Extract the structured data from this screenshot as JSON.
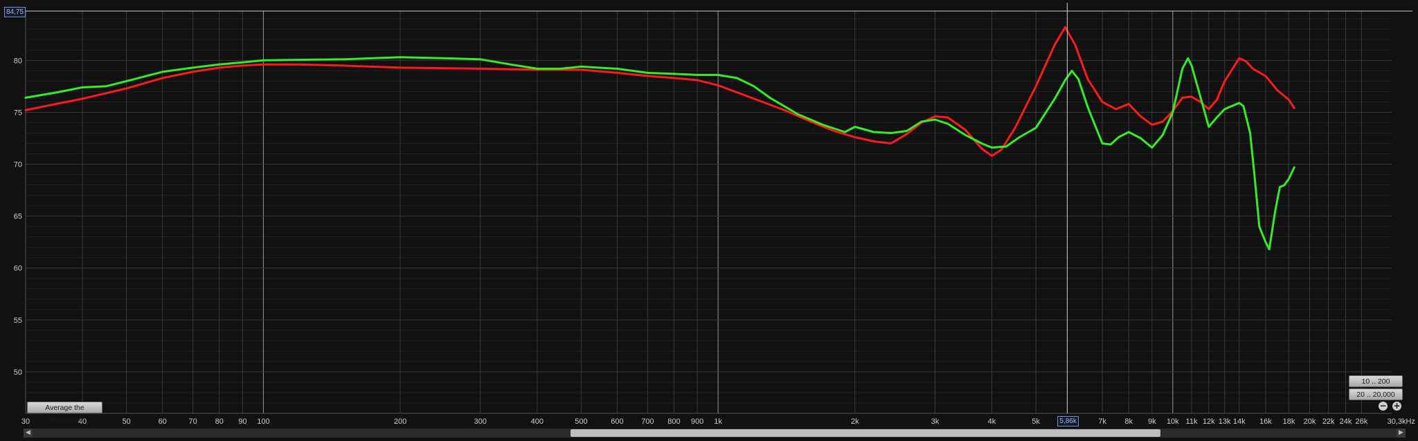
{
  "chart_data": {
    "type": "line",
    "title": "",
    "xlabel": "Hz",
    "ylabel": "",
    "x_scale": "log",
    "xlim": [
      30,
      30300
    ],
    "ylim": [
      46,
      84.75
    ],
    "grid": true,
    "x_tick_labels": [
      "30",
      "40",
      "50",
      "60",
      "70",
      "80",
      "90",
      "100",
      "200",
      "300",
      "400",
      "500",
      "600",
      "700",
      "800",
      "900",
      "1k",
      "2k",
      "3k",
      "4k",
      "5k",
      "7k",
      "8k",
      "9k",
      "10k",
      "11k",
      "12k",
      "13k",
      "14k",
      "16k",
      "18k",
      "20k",
      "22k",
      "24k",
      "26k"
    ],
    "x_tick_values": [
      30,
      40,
      50,
      60,
      70,
      80,
      90,
      100,
      200,
      300,
      400,
      500,
      600,
      700,
      800,
      900,
      1000,
      2000,
      3000,
      4000,
      5000,
      7000,
      8000,
      9000,
      10000,
      11000,
      12000,
      13000,
      14000,
      16000,
      18000,
      20000,
      22000,
      24000,
      26000
    ],
    "x_unit_label": "30,3kHz",
    "y_tick_values": [
      50,
      55,
      60,
      65,
      70,
      75,
      80
    ],
    "y_tick_labels": [
      "50",
      "55",
      "60",
      "65",
      "70",
      "75",
      "80"
    ],
    "series": [
      {
        "color": "#ff1a1a",
        "points": [
          [
            30,
            75.2
          ],
          [
            35,
            75.8
          ],
          [
            40,
            76.3
          ],
          [
            50,
            77.3
          ],
          [
            60,
            78.3
          ],
          [
            70,
            78.9
          ],
          [
            80,
            79.3
          ],
          [
            90,
            79.5
          ],
          [
            100,
            79.6
          ],
          [
            120,
            79.6
          ],
          [
            150,
            79.5
          ],
          [
            200,
            79.3
          ],
          [
            300,
            79.2
          ],
          [
            400,
            79.1
          ],
          [
            500,
            79.1
          ],
          [
            600,
            78.8
          ],
          [
            700,
            78.5
          ],
          [
            800,
            78.3
          ],
          [
            900,
            78.1
          ],
          [
            1000,
            77.6
          ],
          [
            1200,
            76.3
          ],
          [
            1400,
            75.2
          ],
          [
            1600,
            74.1
          ],
          [
            1800,
            73.2
          ],
          [
            2000,
            72.6
          ],
          [
            2200,
            72.2
          ],
          [
            2400,
            72.0
          ],
          [
            2600,
            72.9
          ],
          [
            2800,
            74.0
          ],
          [
            3000,
            74.6
          ],
          [
            3200,
            74.5
          ],
          [
            3500,
            73.3
          ],
          [
            3800,
            71.5
          ],
          [
            4000,
            70.8
          ],
          [
            4200,
            71.4
          ],
          [
            4500,
            73.5
          ],
          [
            5000,
            77.5
          ],
          [
            5500,
            81.5
          ],
          [
            5800,
            83.2
          ],
          [
            6100,
            81.5
          ],
          [
            6500,
            78.2
          ],
          [
            7000,
            76.0
          ],
          [
            7500,
            75.3
          ],
          [
            8000,
            75.8
          ],
          [
            8500,
            74.6
          ],
          [
            9000,
            73.8
          ],
          [
            9500,
            74.1
          ],
          [
            10000,
            75.1
          ],
          [
            10500,
            76.4
          ],
          [
            11000,
            76.5
          ],
          [
            11500,
            76.0
          ],
          [
            12000,
            75.3
          ],
          [
            12500,
            76.2
          ],
          [
            13000,
            78.0
          ],
          [
            14000,
            80.2
          ],
          [
            14500,
            79.9
          ],
          [
            15000,
            79.2
          ],
          [
            16000,
            78.5
          ],
          [
            17000,
            77.1
          ],
          [
            18000,
            76.2
          ],
          [
            18500,
            75.4
          ]
        ]
      },
      {
        "color": "#33ee22",
        "points": [
          [
            30,
            76.4
          ],
          [
            35,
            76.9
          ],
          [
            40,
            77.4
          ],
          [
            45,
            77.5
          ],
          [
            50,
            78.0
          ],
          [
            60,
            78.9
          ],
          [
            70,
            79.3
          ],
          [
            80,
            79.6
          ],
          [
            90,
            79.8
          ],
          [
            100,
            80.0
          ],
          [
            150,
            80.1
          ],
          [
            200,
            80.3
          ],
          [
            250,
            80.2
          ],
          [
            300,
            80.1
          ],
          [
            350,
            79.6
          ],
          [
            400,
            79.2
          ],
          [
            450,
            79.2
          ],
          [
            500,
            79.4
          ],
          [
            600,
            79.2
          ],
          [
            700,
            78.8
          ],
          [
            800,
            78.7
          ],
          [
            900,
            78.6
          ],
          [
            1000,
            78.6
          ],
          [
            1100,
            78.3
          ],
          [
            1200,
            77.5
          ],
          [
            1300,
            76.4
          ],
          [
            1500,
            74.8
          ],
          [
            1700,
            73.8
          ],
          [
            1900,
            73.1
          ],
          [
            2000,
            73.6
          ],
          [
            2200,
            73.1
          ],
          [
            2400,
            73.0
          ],
          [
            2600,
            73.2
          ],
          [
            2800,
            74.1
          ],
          [
            3000,
            74.3
          ],
          [
            3200,
            73.9
          ],
          [
            3500,
            72.8
          ],
          [
            3800,
            72.0
          ],
          [
            4000,
            71.6
          ],
          [
            4300,
            71.7
          ],
          [
            4600,
            72.6
          ],
          [
            5000,
            73.5
          ],
          [
            5500,
            76.3
          ],
          [
            5800,
            78.1
          ],
          [
            6000,
            79.0
          ],
          [
            6200,
            78.2
          ],
          [
            6500,
            75.5
          ],
          [
            7000,
            72.0
          ],
          [
            7300,
            71.9
          ],
          [
            7600,
            72.6
          ],
          [
            8000,
            73.1
          ],
          [
            8500,
            72.5
          ],
          [
            9000,
            71.6
          ],
          [
            9500,
            72.8
          ],
          [
            10000,
            75.0
          ],
          [
            10500,
            79.2
          ],
          [
            10800,
            80.2
          ],
          [
            11000,
            79.5
          ],
          [
            11500,
            76.5
          ],
          [
            12000,
            73.6
          ],
          [
            12500,
            74.5
          ],
          [
            13000,
            75.3
          ],
          [
            14000,
            75.9
          ],
          [
            14300,
            75.6
          ],
          [
            14800,
            73.0
          ],
          [
            15200,
            68.0
          ],
          [
            15500,
            64.0
          ],
          [
            16000,
            62.5
          ],
          [
            16300,
            61.8
          ],
          [
            16800,
            65.5
          ],
          [
            17200,
            67.8
          ],
          [
            17600,
            68.0
          ],
          [
            18000,
            68.6
          ],
          [
            18500,
            69.7
          ]
        ]
      }
    ]
  },
  "cursor": {
    "y_readout": "84,75",
    "freq_readout": "5,86k",
    "freq_value": 5860
  },
  "controls": {
    "average_label": "Average the Responses",
    "range_low_label": "10 .. 200",
    "range_high_label": "20 .. 20,000",
    "zoom_out_glyph": "−",
    "zoom_in_glyph": "+"
  },
  "colors": {
    "background": "#111111",
    "grid_major": "#3a3a3a",
    "grid_minor": "#202020",
    "cursor_line": "#d0d0d0"
  }
}
